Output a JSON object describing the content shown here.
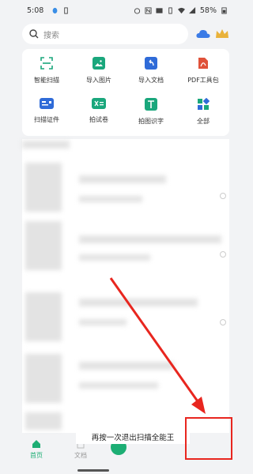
{
  "status_bar": {
    "time": "5:08",
    "battery": "58%"
  },
  "search": {
    "placeholder": "搜索"
  },
  "tools": [
    {
      "label": "智能扫描",
      "icon": "scan-icon",
      "color": "#1aa77c"
    },
    {
      "label": "导入图片",
      "icon": "image-icon",
      "color": "#1aa77c"
    },
    {
      "label": "导入文档",
      "icon": "import-doc-icon",
      "color": "#2f6bd8"
    },
    {
      "label": "PDF工具包",
      "icon": "pdf-icon",
      "color": "#e0523a"
    },
    {
      "label": "扫描证件",
      "icon": "id-card-icon",
      "color": "#2f6bd8"
    },
    {
      "label": "拍试卷",
      "icon": "exam-icon",
      "color": "#1aa77c"
    },
    {
      "label": "拍图识字",
      "icon": "text-recognition-icon",
      "color": "#1aa77c"
    },
    {
      "label": "全部",
      "icon": "grid-icon",
      "color": "#2f6bd8"
    }
  ],
  "toast": {
    "text": "再按一次退出扫描全能王"
  },
  "bottom_nav": {
    "home": "首页",
    "docs": "文档"
  },
  "colors": {
    "accent": "#1dae74",
    "highlight": "#e8261f"
  }
}
